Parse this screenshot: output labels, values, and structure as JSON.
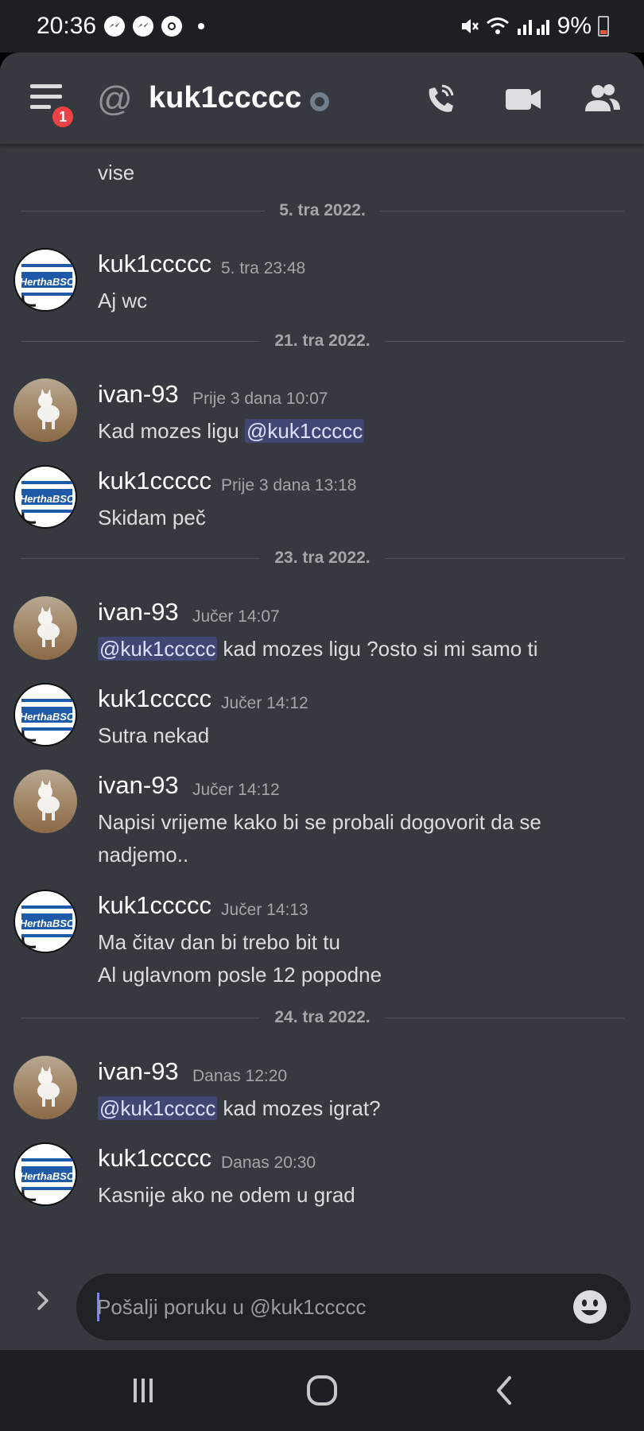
{
  "status_bar": {
    "time": "20:36",
    "battery": "9%"
  },
  "header": {
    "title": "kuk1ccccc",
    "badge_count": "1"
  },
  "chat": {
    "top_fragment": "vise",
    "dividers": [
      "5. tra 2022.",
      "21. tra 2022.",
      "23. tra 2022.",
      "24. tra 2022."
    ],
    "messages": [
      {
        "author": "kuk1ccccc",
        "time": "5. tra 23:48",
        "lines": [
          "Aj wc"
        ]
      },
      {
        "author": "ivan-93",
        "time": "Prije 3 dana 10:07",
        "text_before": "Kad mozes ligu ",
        "mention": "@kuk1ccccc",
        "text_after": ""
      },
      {
        "author": "kuk1ccccc",
        "time": "Prije 3 dana 13:18",
        "lines": [
          "Skidam peč"
        ]
      },
      {
        "author": "ivan-93",
        "time": "Jučer 14:07",
        "mention": "@kuk1ccccc",
        "text_after": " kad mozes ligu ?osto si mi samo ti"
      },
      {
        "author": "kuk1ccccc",
        "time": "Jučer 14:12",
        "lines": [
          "Sutra nekad"
        ]
      },
      {
        "author": "ivan-93",
        "time": "Jučer 14:12",
        "lines": [
          "Napisi vrijeme kako bi se probali dogovorit da se",
          "nadjemo.."
        ]
      },
      {
        "author": "kuk1ccccc",
        "time": "Jučer 14:13",
        "lines": [
          "Ma čitav dan bi trebo bit tu",
          "Al uglavnom posle 12 popodne"
        ]
      },
      {
        "author": "ivan-93",
        "time": "Danas 12:20",
        "mention": "@kuk1ccccc",
        "text_after": " kad mozes igrat?"
      },
      {
        "author": "kuk1ccccc",
        "time": "Danas 20:30",
        "lines": [
          "Kasnije ako ne odem u grad"
        ]
      }
    ]
  },
  "input": {
    "placeholder": "Pošalji poruku u @kuk1ccccc"
  },
  "colors": {
    "background": "#36393f",
    "mention_bg": "#414675",
    "mention_text": "#dee0fc",
    "badge": "#ed4245"
  },
  "icons": {
    "header": [
      "menu-icon",
      "at-icon",
      "status-offline-icon",
      "phone-call-icon",
      "video-camera-icon",
      "members-icon"
    ],
    "input": [
      "chevron-right-icon",
      "emoji-icon"
    ],
    "nav": [
      "recent-apps-icon",
      "home-icon",
      "back-icon"
    ]
  }
}
